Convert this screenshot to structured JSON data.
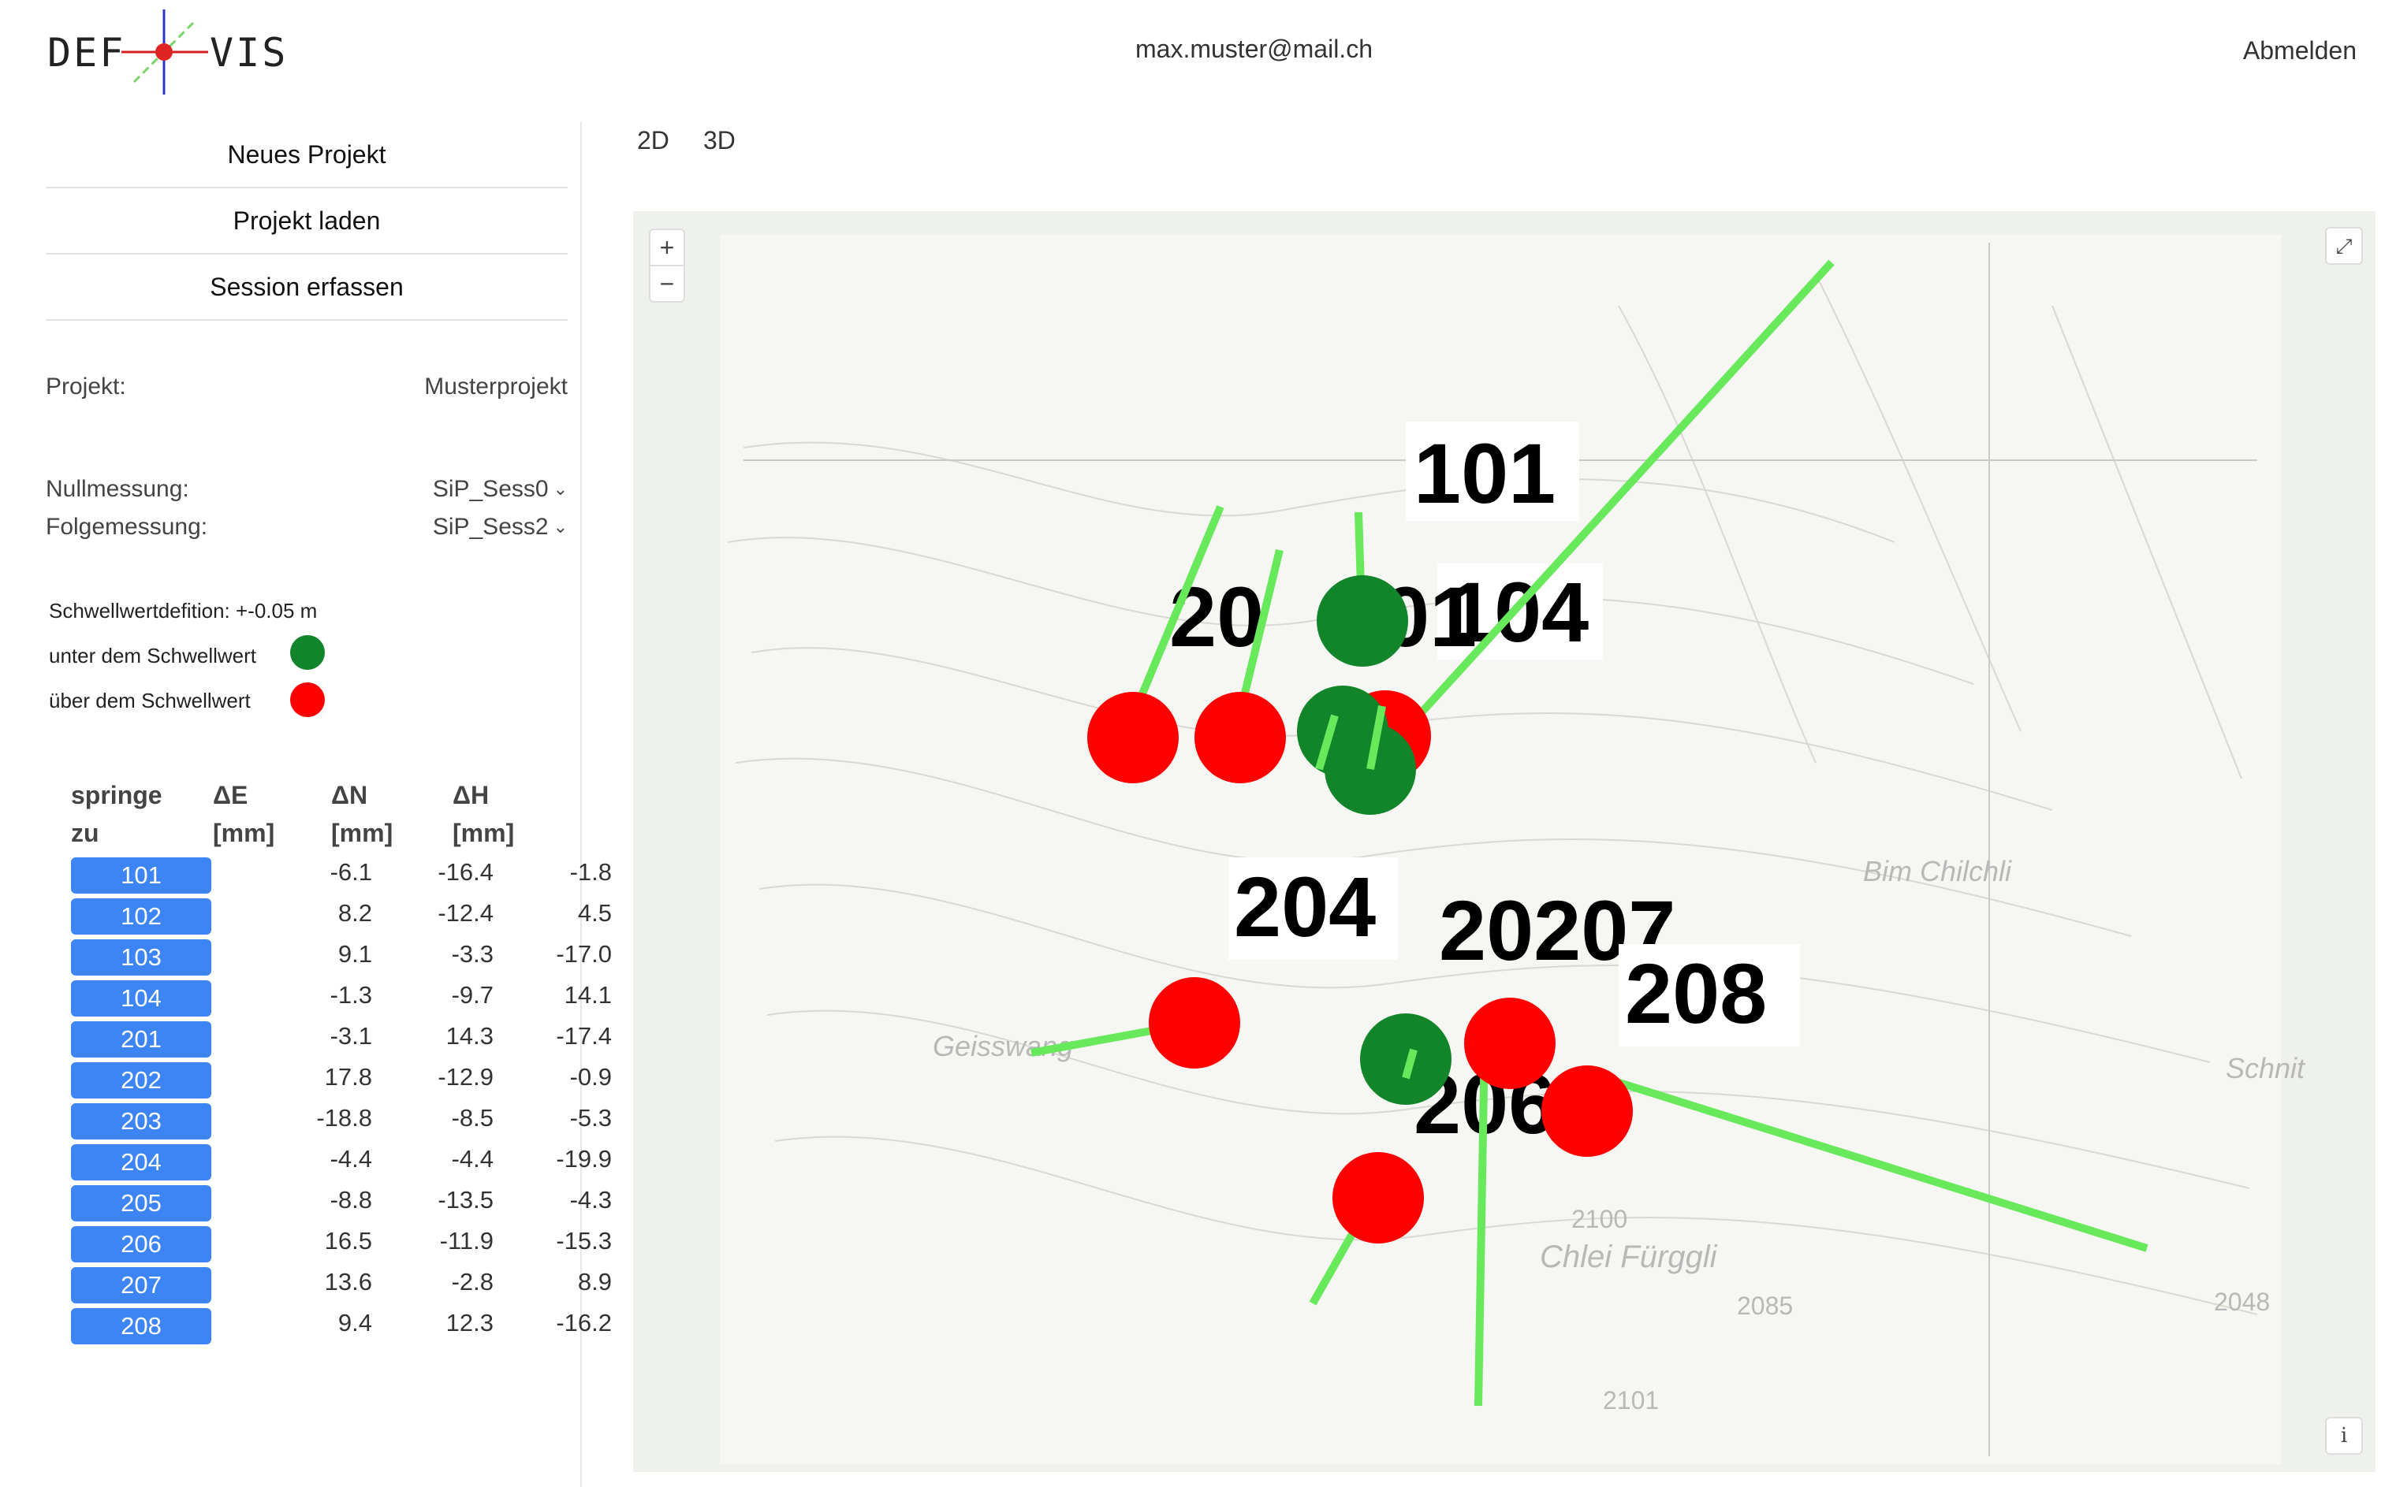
{
  "header": {
    "logo_left": "DEF",
    "logo_right": "VIS",
    "user_email": "max.muster@mail.ch",
    "logout_label": "Abmelden"
  },
  "sidebar": {
    "menu": [
      "Neues Projekt",
      "Projekt laden",
      "Session erfassen"
    ],
    "project_label": "Projekt:",
    "project_value": "Musterprojekt",
    "null_label": "Nullmessung:",
    "null_value": "SiP_Sess0",
    "follow_label": "Folgemessung:",
    "follow_value": "SiP_Sess2",
    "threshold_text": "Schwellwertdefition: +-0.05 m",
    "below_label": "unter dem Schwellwert",
    "above_label": "über dem Schwellwert",
    "below_color": "#12852a",
    "above_color": "#ff0000"
  },
  "table": {
    "headers": [
      [
        "springe",
        "zu"
      ],
      [
        "ΔE",
        "[mm]"
      ],
      [
        "ΔN",
        "[mm]"
      ],
      [
        "ΔH",
        "[mm]"
      ]
    ],
    "rows": [
      {
        "id": "101",
        "de": "-6.1",
        "dn": "-16.4",
        "dh": "-1.8"
      },
      {
        "id": "102",
        "de": "8.2",
        "dn": "-12.4",
        "dh": "4.5"
      },
      {
        "id": "103",
        "de": "9.1",
        "dn": "-3.3",
        "dh": "-17.0"
      },
      {
        "id": "104",
        "de": "-1.3",
        "dn": "-9.7",
        "dh": "14.1"
      },
      {
        "id": "201",
        "de": "-3.1",
        "dn": "14.3",
        "dh": "-17.4"
      },
      {
        "id": "202",
        "de": "17.8",
        "dn": "-12.9",
        "dh": "-0.9"
      },
      {
        "id": "203",
        "de": "-18.8",
        "dn": "-8.5",
        "dh": "-5.3"
      },
      {
        "id": "204",
        "de": "-4.4",
        "dn": "-4.4",
        "dh": "-19.9"
      },
      {
        "id": "205",
        "de": "-8.8",
        "dn": "-13.5",
        "dh": "-4.3"
      },
      {
        "id": "206",
        "de": "16.5",
        "dn": "-11.9",
        "dh": "-15.3"
      },
      {
        "id": "207",
        "de": "13.6",
        "dn": "-2.8",
        "dh": "8.9"
      },
      {
        "id": "208",
        "de": "9.4",
        "dn": "12.3",
        "dh": "-16.2"
      }
    ]
  },
  "map": {
    "tabs": [
      "2D",
      "3D"
    ],
    "zoom_in": "+",
    "zoom_out": "−",
    "fullscreen_icon": "⤢",
    "info_icon": "i",
    "place_labels": [
      "Bim Chilchli",
      "Geisswang",
      "Schnit",
      "Chlei Fürggli",
      "2100",
      "2085",
      "2048",
      "2101"
    ],
    "point_labels": [
      "101",
      "104",
      "20",
      "201",
      "204",
      "20207",
      "208",
      "206"
    ]
  }
}
